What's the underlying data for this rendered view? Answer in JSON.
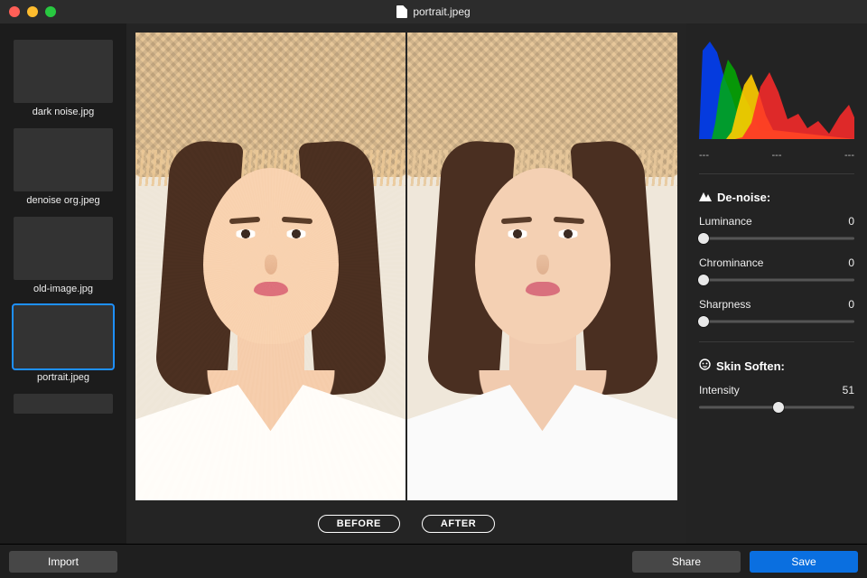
{
  "title": "portrait.jpeg",
  "sidebar": {
    "items": [
      {
        "label": "dark noise.jpg"
      },
      {
        "label": "denoise org.jpeg"
      },
      {
        "label": "old-image.jpg"
      },
      {
        "label": "portrait.jpeg"
      }
    ]
  },
  "compare": {
    "before": "BEFORE",
    "after": "AFTER"
  },
  "histogram": {
    "readout": [
      "---",
      "---",
      "---"
    ]
  },
  "panel": {
    "denoise": {
      "title": "De-noise:",
      "luminance": {
        "label": "Luminance",
        "value": 0
      },
      "chrominance": {
        "label": "Chrominance",
        "value": 0
      },
      "sharpness": {
        "label": "Sharpness",
        "value": 0
      }
    },
    "skin": {
      "title": "Skin Soften:",
      "intensity": {
        "label": "Intensity",
        "value": 51
      }
    }
  },
  "footer": {
    "import": "Import",
    "share": "Share",
    "save": "Save"
  }
}
